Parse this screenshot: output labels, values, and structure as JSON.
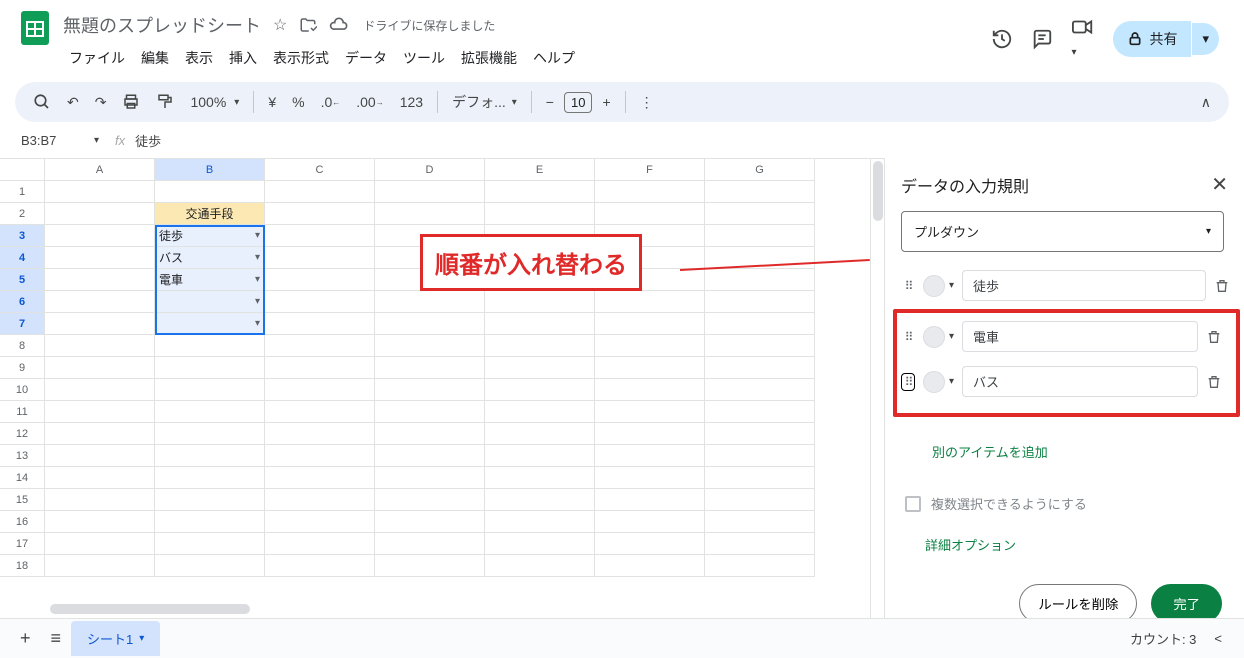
{
  "header": {
    "title": "無題のスプレッドシート",
    "saved_text": "ドライブに保存しました",
    "menus": [
      "ファイル",
      "編集",
      "表示",
      "挿入",
      "表示形式",
      "データ",
      "ツール",
      "拡張機能",
      "ヘルプ"
    ],
    "share_label": "共有"
  },
  "toolbar": {
    "zoom": "100%",
    "font": "デフォ...",
    "font_size": "10"
  },
  "namebox": {
    "ref": "B3:B7",
    "formula": "徒歩"
  },
  "grid": {
    "columns": [
      "A",
      "B",
      "C",
      "D",
      "E",
      "F",
      "G"
    ],
    "selected_col": "B",
    "row_count": 18,
    "selected_rows": [
      3,
      4,
      5,
      6,
      7
    ],
    "header_cell": {
      "row": 2,
      "col": "B",
      "value": "交通手段"
    },
    "dropdown_cells": [
      {
        "row": 3,
        "value": "徒歩"
      },
      {
        "row": 4,
        "value": "バス"
      },
      {
        "row": 5,
        "value": "電車"
      },
      {
        "row": 6,
        "value": ""
      },
      {
        "row": 7,
        "value": ""
      }
    ]
  },
  "callout": {
    "text": "順番が入れ替わる"
  },
  "sidepanel": {
    "title": "データの入力規則",
    "criteria": "プルダウン",
    "items": [
      {
        "value": "徒歩"
      },
      {
        "value": "電車"
      },
      {
        "value": "バス"
      }
    ],
    "add_item": "別のアイテムを追加",
    "multi_select": "複数選択できるようにする",
    "advanced": "詳細オプション",
    "delete_rule": "ルールを削除",
    "done": "完了"
  },
  "bottombar": {
    "sheet_name": "シート1",
    "count_label": "カウント: 3"
  }
}
